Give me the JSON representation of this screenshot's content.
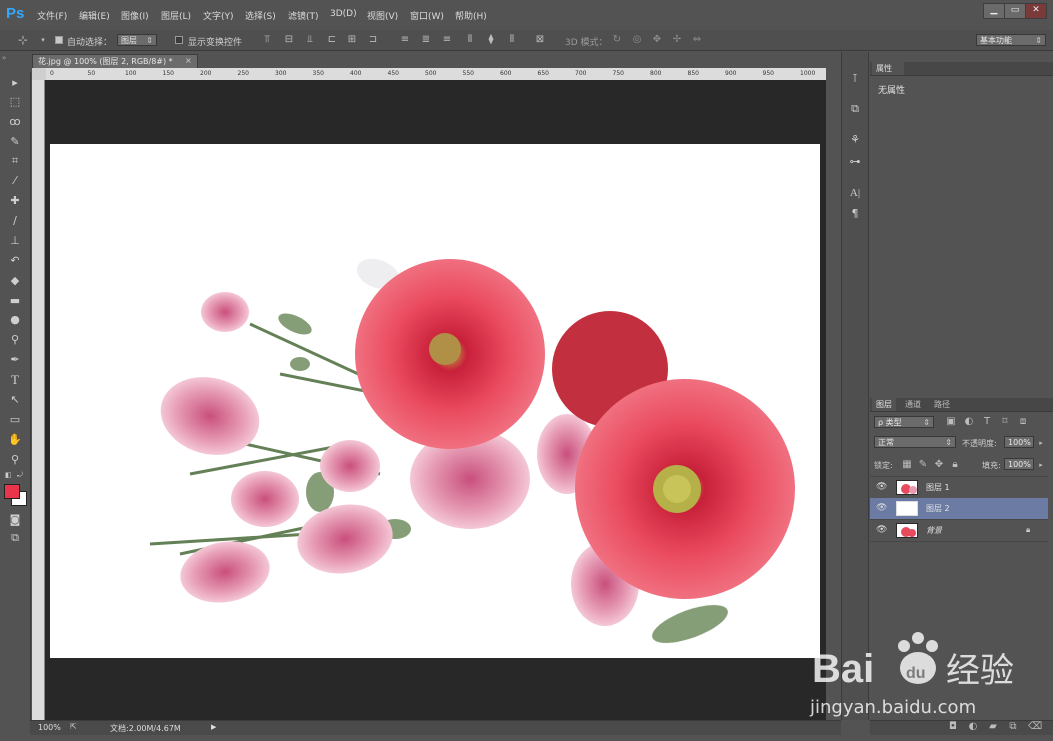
{
  "app": {
    "logo": "Ps"
  },
  "menu": [
    "文件(F)",
    "编辑(E)",
    "图像(I)",
    "图层(L)",
    "文字(Y)",
    "选择(S)",
    "滤镜(T)",
    "3D(D)",
    "视图(V)",
    "窗口(W)",
    "帮助(H)"
  ],
  "window_controls": [
    "minimize-icon",
    "maximize-icon",
    "close-icon"
  ],
  "options": {
    "auto_select_label": "自动选择：",
    "auto_select_value": "图层",
    "show_transform_label": "显示变换控件",
    "mode_3d_label": "3D 模式：",
    "workspace_value": "基本功能"
  },
  "document": {
    "tab_title": "花.jpg @ 100% (图层 2, RGB/8#) *",
    "close_glyph": "×"
  },
  "ruler_labels": [
    "0",
    "50",
    "100",
    "150",
    "200",
    "250",
    "300",
    "350",
    "400",
    "450",
    "500",
    "550",
    "600",
    "650",
    "700",
    "750",
    "800",
    "850",
    "900",
    "950",
    "1000"
  ],
  "properties_panel": {
    "tab": "属性",
    "empty_text": "无属性"
  },
  "layers_panel": {
    "tabs": [
      "图层",
      "通道",
      "路径"
    ],
    "filter_label": "ρ 类型",
    "blend_mode": "正常",
    "opacity_label": "不透明度:",
    "opacity_value": "100%",
    "lock_label": "锁定:",
    "fill_label": "填充:",
    "fill_value": "100%",
    "layers": [
      {
        "name": "图层 1",
        "selected": false
      },
      {
        "name": "图层 2",
        "selected": true
      },
      {
        "name": "背景",
        "selected": false
      }
    ]
  },
  "status": {
    "zoom": "100%",
    "doc_size": "文档:2.00M/4.67M"
  },
  "watermark": {
    "brand": "Bai",
    "brand2": "du",
    "product": "经验",
    "url": "jingyan.baidu.com"
  },
  "colors": {
    "foreground": "#e8354b",
    "background": "#ffffff",
    "selected_layer": "#6b7ba3",
    "accent": "#31a8ff"
  }
}
